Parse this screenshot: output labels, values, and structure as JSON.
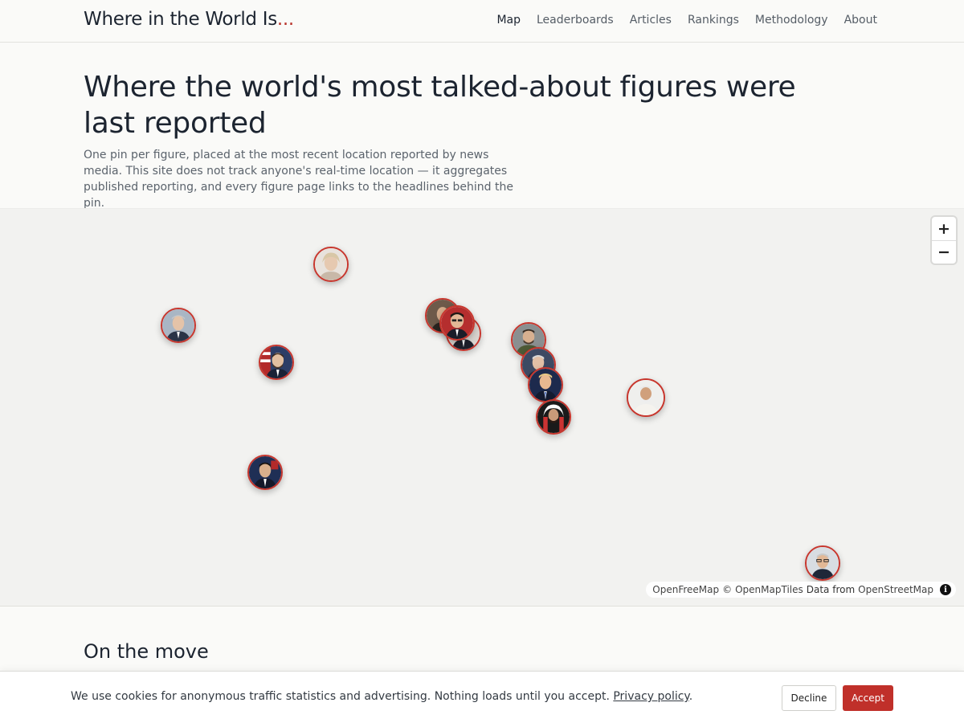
{
  "header": {
    "brand": "Where in the World Is",
    "brand_suffix": "...",
    "nav": [
      "Map",
      "Leaderboards",
      "Articles",
      "Rankings",
      "Methodology",
      "About"
    ],
    "active_nav": "Map"
  },
  "hero": {
    "title": "Where the world's most talked-about figures were last reported",
    "subtitle": "One pin per figure, placed at the most recent location reported by news media. This site does not track anyone's real-time location — it aggregates published reporting, and every figure page links to the headlines behind the pin."
  },
  "map": {
    "zoom_in": "+",
    "zoom_out": "−",
    "attribution": {
      "openfreemap": "OpenFreeMap",
      "copyright": "©",
      "openmaptiles": "OpenMapTiles",
      "data_from": "Data from",
      "osm": "OpenStreetMap",
      "info": "i"
    },
    "accent_color": "#c8362d"
  },
  "sections": {
    "on_the_move": "On the move"
  },
  "cookie": {
    "text": "We use cookies for anonymous traffic statistics and advertising. Nothing loads until you accept.",
    "policy_link": "Privacy policy",
    "period": ".",
    "decline": "Decline",
    "accept": "Accept"
  }
}
